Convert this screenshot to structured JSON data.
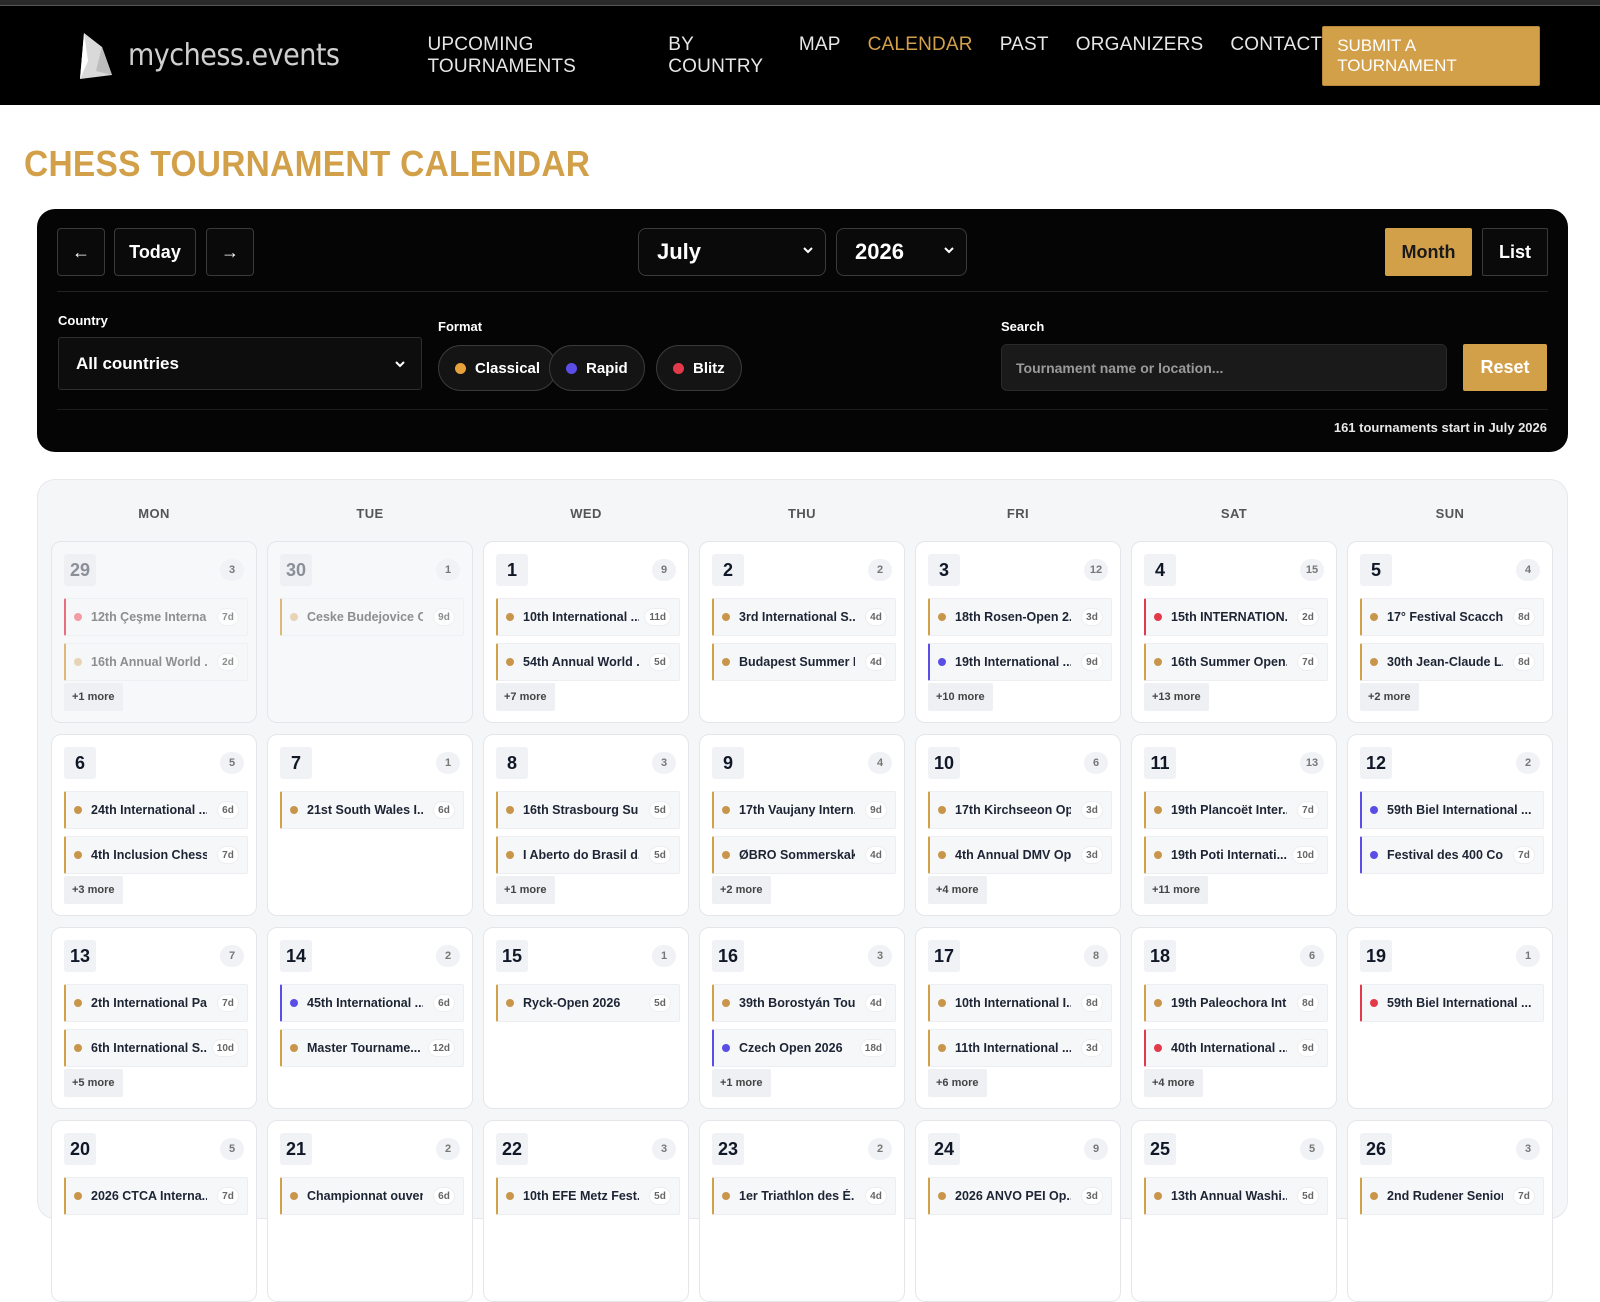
{
  "brand": {
    "name_part1": "mychess",
    "name_part2": ".events"
  },
  "nav": {
    "items": [
      {
        "label": "UPCOMING TOURNAMENTS",
        "active": false
      },
      {
        "label": "BY COUNTRY",
        "active": false
      },
      {
        "label": "MAP",
        "active": false
      },
      {
        "label": "CALENDAR",
        "active": true
      },
      {
        "label": "PAST",
        "active": false
      },
      {
        "label": "ORGANIZERS",
        "active": false
      },
      {
        "label": "CONTACT",
        "active": false
      }
    ],
    "submit_label": "SUBMIT A TOURNAMENT"
  },
  "page_title": "CHESS TOURNAMENT CALENDAR",
  "controls": {
    "prev_label": "←",
    "today_label": "Today",
    "next_label": "→",
    "month_value": "July",
    "year_value": "2026",
    "view_month_label": "Month",
    "view_list_label": "List",
    "active_view": "Month"
  },
  "filters": {
    "country_label": "Country",
    "country_value": "All countries",
    "format_label": "Format",
    "formats": [
      {
        "label": "Classical",
        "color": "#e6a23a"
      },
      {
        "label": "Rapid",
        "color": "#5a4ee6"
      },
      {
        "label": "Blitz",
        "color": "#e23a4a"
      }
    ],
    "search_label": "Search",
    "search_placeholder": "Tournament name or location...",
    "reset_label": "Reset"
  },
  "summary": "161 tournaments start in July 2026",
  "colors": {
    "accent": "#d3a04a",
    "classical": "#c8954a",
    "rapid": "#5a4ee6",
    "blitz": "#e23a4a"
  },
  "weekdays": [
    "MON",
    "TUE",
    "WED",
    "THU",
    "FRI",
    "SAT",
    "SUN"
  ],
  "days": [
    {
      "day": "29",
      "count": "3",
      "other": true,
      "events": [
        {
          "name": "12th Çeşme Interna...",
          "dur": "7d",
          "format": "blitz"
        },
        {
          "name": "16th Annual World ...",
          "dur": "2d",
          "format": "classical"
        }
      ],
      "more": "+1 more"
    },
    {
      "day": "30",
      "count": "1",
      "other": true,
      "events": [
        {
          "name": "Ceske Budejovice C...",
          "dur": "9d",
          "format": "classical"
        }
      ],
      "more": ""
    },
    {
      "day": "1",
      "count": "9",
      "events": [
        {
          "name": "10th International ...",
          "dur": "11d",
          "format": "classical"
        },
        {
          "name": "54th Annual World ...",
          "dur": "5d",
          "format": "classical"
        }
      ],
      "more": "+7 more"
    },
    {
      "day": "2",
      "count": "2",
      "events": [
        {
          "name": "3rd International S...",
          "dur": "4d",
          "format": "classical"
        },
        {
          "name": "Budapest Summer I...",
          "dur": "4d",
          "format": "classical"
        }
      ],
      "more": ""
    },
    {
      "day": "3",
      "count": "12",
      "events": [
        {
          "name": "18th Rosen-Open 2...",
          "dur": "3d",
          "format": "classical"
        },
        {
          "name": "19th International ...",
          "dur": "9d",
          "format": "rapid"
        }
      ],
      "more": "+10 more"
    },
    {
      "day": "4",
      "count": "15",
      "events": [
        {
          "name": "15th INTERNATION...",
          "dur": "2d",
          "format": "blitz"
        },
        {
          "name": "16th Summer Open...",
          "dur": "7d",
          "format": "classical"
        }
      ],
      "more": "+13 more"
    },
    {
      "day": "5",
      "count": "4",
      "events": [
        {
          "name": "17° Festival Scacch...",
          "dur": "8d",
          "format": "classical"
        },
        {
          "name": "30th Jean-Claude L...",
          "dur": "8d",
          "format": "classical"
        }
      ],
      "more": "+2 more"
    },
    {
      "day": "6",
      "count": "5",
      "events": [
        {
          "name": "24th International ...",
          "dur": "6d",
          "format": "classical"
        },
        {
          "name": "4th Inclusion Chess...",
          "dur": "7d",
          "format": "classical"
        }
      ],
      "more": "+3 more"
    },
    {
      "day": "7",
      "count": "1",
      "events": [
        {
          "name": "21st South Wales I...",
          "dur": "6d",
          "format": "classical"
        }
      ],
      "more": ""
    },
    {
      "day": "8",
      "count": "3",
      "events": [
        {
          "name": "16th Strasbourg Su...",
          "dur": "5d",
          "format": "classical"
        },
        {
          "name": "I Aberto do Brasil d...",
          "dur": "5d",
          "format": "classical"
        }
      ],
      "more": "+1 more"
    },
    {
      "day": "9",
      "count": "4",
      "events": [
        {
          "name": "17th Vaujany Intern...",
          "dur": "9d",
          "format": "classical"
        },
        {
          "name": "ØBRO Sommerskak...",
          "dur": "4d",
          "format": "classical"
        }
      ],
      "more": "+2 more"
    },
    {
      "day": "10",
      "count": "6",
      "events": [
        {
          "name": "17th Kirchseeon Op...",
          "dur": "3d",
          "format": "classical"
        },
        {
          "name": "4th Annual DMV Op...",
          "dur": "3d",
          "format": "classical"
        }
      ],
      "more": "+4 more"
    },
    {
      "day": "11",
      "count": "13",
      "events": [
        {
          "name": "19th Plancoët Inter...",
          "dur": "7d",
          "format": "classical"
        },
        {
          "name": "19th Poti Internati...",
          "dur": "10d",
          "format": "classical"
        }
      ],
      "more": "+11 more"
    },
    {
      "day": "12",
      "count": "2",
      "events": [
        {
          "name": "59th Biel International ...",
          "dur": "",
          "format": "rapid"
        },
        {
          "name": "Festival des 400 Co...",
          "dur": "7d",
          "format": "rapid"
        }
      ],
      "more": ""
    },
    {
      "day": "13",
      "count": "7",
      "events": [
        {
          "name": "2th International Pa...",
          "dur": "7d",
          "format": "classical"
        },
        {
          "name": "6th International S...",
          "dur": "10d",
          "format": "classical"
        }
      ],
      "more": "+5 more"
    },
    {
      "day": "14",
      "count": "2",
      "events": [
        {
          "name": "45th International ...",
          "dur": "6d",
          "format": "rapid"
        },
        {
          "name": "Master Tourname...",
          "dur": "12d",
          "format": "classical"
        }
      ],
      "more": ""
    },
    {
      "day": "15",
      "count": "1",
      "events": [
        {
          "name": "Ryck-Open 2026",
          "dur": "5d",
          "format": "classical"
        }
      ],
      "more": ""
    },
    {
      "day": "16",
      "count": "3",
      "events": [
        {
          "name": "39th Borostyán Tou...",
          "dur": "4d",
          "format": "classical"
        },
        {
          "name": "Czech Open 2026",
          "dur": "18d",
          "format": "rapid"
        }
      ],
      "more": "+1 more"
    },
    {
      "day": "17",
      "count": "8",
      "events": [
        {
          "name": "10th International I...",
          "dur": "8d",
          "format": "classical"
        },
        {
          "name": "11th International ...",
          "dur": "3d",
          "format": "classical"
        }
      ],
      "more": "+6 more"
    },
    {
      "day": "18",
      "count": "6",
      "events": [
        {
          "name": "19th Paleochora Int...",
          "dur": "8d",
          "format": "classical"
        },
        {
          "name": "40th International ...",
          "dur": "9d",
          "format": "blitz"
        }
      ],
      "more": "+4 more"
    },
    {
      "day": "19",
      "count": "1",
      "events": [
        {
          "name": "59th Biel International ...",
          "dur": "",
          "format": "blitz"
        }
      ],
      "more": ""
    },
    {
      "day": "20",
      "count": "5",
      "events": [
        {
          "name": "2026 CTCA Interna...",
          "dur": "7d",
          "format": "classical"
        }
      ],
      "more": ""
    },
    {
      "day": "21",
      "count": "2",
      "events": [
        {
          "name": "Championnat ouver...",
          "dur": "6d",
          "format": "classical"
        }
      ],
      "more": ""
    },
    {
      "day": "22",
      "count": "3",
      "events": [
        {
          "name": "10th EFE Metz Fest...",
          "dur": "5d",
          "format": "classical"
        }
      ],
      "more": ""
    },
    {
      "day": "23",
      "count": "2",
      "events": [
        {
          "name": "1er Triathlon des É...",
          "dur": "4d",
          "format": "classical"
        }
      ],
      "more": ""
    },
    {
      "day": "24",
      "count": "9",
      "events": [
        {
          "name": "2026 ANVO PEI Op...",
          "dur": "3d",
          "format": "classical"
        }
      ],
      "more": ""
    },
    {
      "day": "25",
      "count": "5",
      "events": [
        {
          "name": "13th Annual Washi...",
          "dur": "5d",
          "format": "classical"
        }
      ],
      "more": ""
    },
    {
      "day": "26",
      "count": "3",
      "events": [
        {
          "name": "2nd Rudener Senior...",
          "dur": "7d",
          "format": "classical"
        }
      ],
      "more": ""
    }
  ]
}
